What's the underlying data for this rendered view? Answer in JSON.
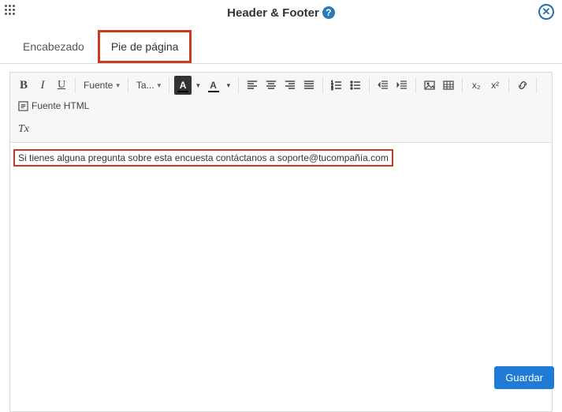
{
  "header": {
    "title": "Header & Footer",
    "help_label": "?",
    "close_label": "✕"
  },
  "tabs": {
    "header": "Encabezado",
    "footer": "Pie de página"
  },
  "toolbar": {
    "bold": "B",
    "italic": "I",
    "underline": "U",
    "font": "Fuente",
    "size": "Ta...",
    "txcolor": "A",
    "bgcolor": "A",
    "subscript": "x₂",
    "superscript": "x²",
    "source": "Fuente HTML",
    "removefmt": "Tx"
  },
  "content": {
    "line1": "Si tienes alguna pregunta sobre esta encuesta contáctanos a soporte@tucompañía.com"
  },
  "buttons": {
    "save": "Guardar"
  }
}
